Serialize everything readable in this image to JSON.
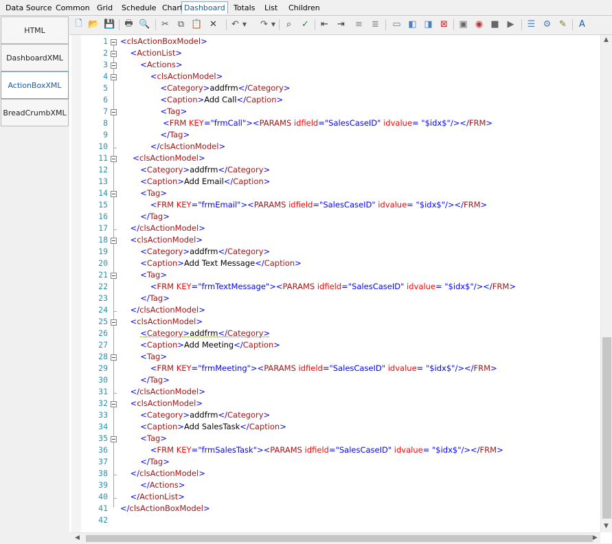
{
  "menu": {
    "items": [
      {
        "label": "Data Source"
      },
      {
        "label": "Common"
      },
      {
        "label": "Grid"
      },
      {
        "label": "Schedule"
      },
      {
        "label": "Chart"
      },
      {
        "label": "Dashboard"
      },
      {
        "label": "Totals"
      },
      {
        "label": "List"
      },
      {
        "label": "Children"
      }
    ],
    "active": "Dashboard"
  },
  "nav_tabs": [
    {
      "label": "HTML"
    },
    {
      "label": "DashboardXML"
    },
    {
      "label": "ActionBoxXML"
    },
    {
      "label": "BreadCrumbXML"
    }
  ],
  "selected_tab": "ActionBoxXML",
  "toolbar_icons": [
    "new-document-icon",
    "open-folder-icon",
    "save-icon",
    "print-icon",
    "print-preview-icon",
    "cut-icon",
    "copy-icon",
    "paste-icon",
    "delete-icon",
    "undo-icon",
    "redo-icon",
    "find-icon",
    "spell-check-icon",
    "outdent-icon",
    "indent-icon",
    "comment-icon",
    "uncomment-icon",
    "bookmark-icon",
    "bookmark-prev-icon",
    "bookmark-next-icon",
    "bookmark-clear-icon",
    "macro-icon",
    "macro-record-icon",
    "macro-stop-icon",
    "macro-play-icon",
    "properties-icon",
    "format-icon",
    "highlight-icon",
    "font-icon"
  ],
  "code_lines": [
    [
      [
        "tk",
        "<"
      ],
      [
        "tn",
        "clsActionBoxModel"
      ],
      [
        "tk",
        ">"
      ]
    ],
    [
      [
        "tx",
        "    "
      ],
      [
        "tk",
        "<"
      ],
      [
        "tn",
        "ActionList"
      ],
      [
        "tk",
        ">"
      ]
    ],
    [
      [
        "tx",
        "        "
      ],
      [
        "tk",
        "<"
      ],
      [
        "tn",
        "Actions"
      ],
      [
        "tk",
        ">"
      ]
    ],
    [
      [
        "tx",
        "            "
      ],
      [
        "tk",
        "<"
      ],
      [
        "tn",
        "clsActionModel"
      ],
      [
        "tk",
        ">"
      ]
    ],
    [
      [
        "tx",
        "                "
      ],
      [
        "tk",
        "<"
      ],
      [
        "tn",
        "Category"
      ],
      [
        "tk",
        ">"
      ],
      [
        "tx",
        "addfrm"
      ],
      [
        "tk",
        "</"
      ],
      [
        "tn",
        "Category"
      ],
      [
        "tk",
        ">"
      ]
    ],
    [
      [
        "tx",
        "                "
      ],
      [
        "tk",
        "<"
      ],
      [
        "tn",
        "Caption"
      ],
      [
        "tk",
        ">"
      ],
      [
        "tx",
        "Add Call"
      ],
      [
        "tk",
        "</"
      ],
      [
        "tn",
        "Caption"
      ],
      [
        "tk",
        ">"
      ]
    ],
    [
      [
        "tx",
        "                "
      ],
      [
        "tk",
        "<"
      ],
      [
        "tn",
        "Tag"
      ],
      [
        "tk",
        ">"
      ]
    ],
    [
      [
        "tx",
        "                 "
      ],
      [
        "tk",
        "<"
      ],
      [
        "tn",
        "FRM"
      ],
      [
        "at",
        " KEY"
      ],
      [
        "tk",
        "="
      ],
      [
        "av",
        "\"frmCall\""
      ],
      [
        "tk",
        ">"
      ],
      [
        "tk",
        "<"
      ],
      [
        "tn",
        "PARAMS"
      ],
      [
        "at",
        " idfield"
      ],
      [
        "tk",
        "="
      ],
      [
        "av",
        "\"SalesCaseID\""
      ],
      [
        "at",
        " idvalue"
      ],
      [
        "tk",
        "= "
      ],
      [
        "av",
        "\"$idx$\""
      ],
      [
        "tk",
        "/></"
      ],
      [
        "tn",
        "FRM"
      ],
      [
        "tk",
        ">"
      ]
    ],
    [
      [
        "tx",
        "                "
      ],
      [
        "tk",
        "</"
      ],
      [
        "tn",
        "Tag"
      ],
      [
        "tk",
        ">"
      ]
    ],
    [
      [
        "tx",
        "            "
      ],
      [
        "tk",
        "</"
      ],
      [
        "tn",
        "clsActionModel"
      ],
      [
        "tk",
        ">"
      ]
    ],
    [
      [
        "tx",
        "     "
      ],
      [
        "tk",
        "<"
      ],
      [
        "tn",
        "clsActionModel"
      ],
      [
        "tk",
        ">"
      ]
    ],
    [
      [
        "tx",
        "        "
      ],
      [
        "tk",
        "<"
      ],
      [
        "tn",
        "Category"
      ],
      [
        "tk",
        ">"
      ],
      [
        "tx",
        "addfrm"
      ],
      [
        "tk",
        "</"
      ],
      [
        "tn",
        "Category"
      ],
      [
        "tk",
        ">"
      ]
    ],
    [
      [
        "tx",
        "        "
      ],
      [
        "tk",
        "<"
      ],
      [
        "tn",
        "Caption"
      ],
      [
        "tk",
        ">"
      ],
      [
        "tx",
        "Add Email"
      ],
      [
        "tk",
        "</"
      ],
      [
        "tn",
        "Caption"
      ],
      [
        "tk",
        ">"
      ]
    ],
    [
      [
        "tx",
        "        "
      ],
      [
        "tk",
        "<"
      ],
      [
        "tn",
        "Tag"
      ],
      [
        "tk",
        ">"
      ]
    ],
    [
      [
        "tx",
        "            "
      ],
      [
        "tk",
        "<"
      ],
      [
        "tn",
        "FRM"
      ],
      [
        "at",
        " KEY"
      ],
      [
        "tk",
        "="
      ],
      [
        "av",
        "\"frmEmail\""
      ],
      [
        "tk",
        ">"
      ],
      [
        "tk",
        "<"
      ],
      [
        "tn",
        "PARAMS"
      ],
      [
        "at",
        " idfield"
      ],
      [
        "tk",
        "="
      ],
      [
        "av",
        "\"SalesCaseID\""
      ],
      [
        "at",
        " idvalue"
      ],
      [
        "tk",
        "= "
      ],
      [
        "av",
        "\"$idx$\""
      ],
      [
        "tk",
        "/></"
      ],
      [
        "tn",
        "FRM"
      ],
      [
        "tk",
        ">"
      ]
    ],
    [
      [
        "tx",
        "        "
      ],
      [
        "tk",
        "</"
      ],
      [
        "tn",
        "Tag"
      ],
      [
        "tk",
        ">"
      ]
    ],
    [
      [
        "tx",
        "    "
      ],
      [
        "tk",
        "</"
      ],
      [
        "tn",
        "clsActionModel"
      ],
      [
        "tk",
        ">"
      ]
    ],
    [
      [
        "tx",
        "    "
      ],
      [
        "tk",
        "<"
      ],
      [
        "tn",
        "clsActionModel"
      ],
      [
        "tk",
        ">"
      ]
    ],
    [
      [
        "tx",
        "        "
      ],
      [
        "tk",
        "<"
      ],
      [
        "tn",
        "Category"
      ],
      [
        "tk",
        ">"
      ],
      [
        "tx",
        "addfrm"
      ],
      [
        "tk",
        "</"
      ],
      [
        "tn",
        "Category"
      ],
      [
        "tk",
        ">"
      ]
    ],
    [
      [
        "tx",
        "        "
      ],
      [
        "tk",
        "<"
      ],
      [
        "tn",
        "Caption"
      ],
      [
        "tk",
        ">"
      ],
      [
        "tx",
        "Add Text Message"
      ],
      [
        "tk",
        "</"
      ],
      [
        "tn",
        "Caption"
      ],
      [
        "tk",
        ">"
      ]
    ],
    [
      [
        "tx",
        "        "
      ],
      [
        "tk",
        "<"
      ],
      [
        "tn",
        "Tag"
      ],
      [
        "tk",
        ">"
      ]
    ],
    [
      [
        "tx",
        "            "
      ],
      [
        "tk",
        "<"
      ],
      [
        "tn",
        "FRM"
      ],
      [
        "at",
        " KEY"
      ],
      [
        "tk",
        "="
      ],
      [
        "av",
        "\"frmTextMessage\""
      ],
      [
        "tk",
        ">"
      ],
      [
        "tk",
        "<"
      ],
      [
        "tn",
        "PARAMS"
      ],
      [
        "at",
        " idfield"
      ],
      [
        "tk",
        "="
      ],
      [
        "av",
        "\"SalesCaseID\""
      ],
      [
        "at",
        " idvalue"
      ],
      [
        "tk",
        "= "
      ],
      [
        "av",
        "\"$idx$\""
      ],
      [
        "tk",
        "/></"
      ],
      [
        "tn",
        "FRM"
      ],
      [
        "tk",
        ">"
      ]
    ],
    [
      [
        "tx",
        "        "
      ],
      [
        "tk",
        "</"
      ],
      [
        "tn",
        "Tag"
      ],
      [
        "tk",
        ">"
      ]
    ],
    [
      [
        "tx",
        "    "
      ],
      [
        "tk",
        "</"
      ],
      [
        "tn",
        "clsActionModel"
      ],
      [
        "tk",
        ">"
      ]
    ],
    [
      [
        "tx",
        "    "
      ],
      [
        "tk",
        "<"
      ],
      [
        "tn",
        "clsActionModel"
      ],
      [
        "tk",
        ">"
      ]
    ],
    [
      [
        "tx",
        "        "
      ],
      [
        "tk",
        "<"
      ],
      [
        "tn",
        "Category"
      ],
      [
        "tk",
        ">"
      ],
      [
        "tx",
        "addfrm"
      ],
      [
        "tk",
        "</"
      ],
      [
        "tn",
        "Category"
      ],
      [
        "tk",
        ">"
      ]
    ],
    [
      [
        "tx",
        "        "
      ],
      [
        "tk",
        "<"
      ],
      [
        "tn",
        "Caption"
      ],
      [
        "tk",
        ">"
      ],
      [
        "tx",
        "Add Meeting"
      ],
      [
        "tk",
        "</"
      ],
      [
        "tn",
        "Caption"
      ],
      [
        "tk",
        ">"
      ]
    ],
    [
      [
        "tx",
        "        "
      ],
      [
        "tk",
        "<"
      ],
      [
        "tn",
        "Tag"
      ],
      [
        "tk",
        ">"
      ]
    ],
    [
      [
        "tx",
        "            "
      ],
      [
        "tk",
        "<"
      ],
      [
        "tn",
        "FRM"
      ],
      [
        "at",
        " KEY"
      ],
      [
        "tk",
        "="
      ],
      [
        "av",
        "\"frmMeeting\""
      ],
      [
        "tk",
        ">"
      ],
      [
        "tk",
        "<"
      ],
      [
        "tn",
        "PARAMS"
      ],
      [
        "at",
        " idfield"
      ],
      [
        "tk",
        "="
      ],
      [
        "av",
        "\"SalesCaseID\""
      ],
      [
        "at",
        " idvalue"
      ],
      [
        "tk",
        "= "
      ],
      [
        "av",
        "\"$idx$\""
      ],
      [
        "tk",
        "/></"
      ],
      [
        "tn",
        "FRM"
      ],
      [
        "tk",
        ">"
      ]
    ],
    [
      [
        "tx",
        "        "
      ],
      [
        "tk",
        "</"
      ],
      [
        "tn",
        "Tag"
      ],
      [
        "tk",
        ">"
      ]
    ],
    [
      [
        "tx",
        "    "
      ],
      [
        "tk",
        "</"
      ],
      [
        "tn",
        "clsActionModel"
      ],
      [
        "tk",
        ">"
      ]
    ],
    [
      [
        "tx",
        "    "
      ],
      [
        "tk",
        "<"
      ],
      [
        "tn",
        "clsActionModel"
      ],
      [
        "tk",
        ">"
      ]
    ],
    [
      [
        "tx",
        "        "
      ],
      [
        "tk",
        "<"
      ],
      [
        "tn",
        "Category"
      ],
      [
        "tk",
        ">"
      ],
      [
        "tx",
        "addfrm"
      ],
      [
        "tk",
        "</"
      ],
      [
        "tn",
        "Category"
      ],
      [
        "tk",
        ">"
      ]
    ],
    [
      [
        "tx",
        "        "
      ],
      [
        "tk",
        "<"
      ],
      [
        "tn",
        "Caption"
      ],
      [
        "tk",
        ">"
      ],
      [
        "tx",
        "Add SalesTask"
      ],
      [
        "tk",
        "</"
      ],
      [
        "tn",
        "Caption"
      ],
      [
        "tk",
        ">"
      ]
    ],
    [
      [
        "tx",
        "        "
      ],
      [
        "tk",
        "<"
      ],
      [
        "tn",
        "Tag"
      ],
      [
        "tk",
        ">"
      ]
    ],
    [
      [
        "tx",
        "            "
      ],
      [
        "tk",
        "<"
      ],
      [
        "tn",
        "FRM"
      ],
      [
        "at",
        " KEY"
      ],
      [
        "tk",
        "="
      ],
      [
        "av",
        "\"frmSalesTask\""
      ],
      [
        "tk",
        ">"
      ],
      [
        "tk",
        "<"
      ],
      [
        "tn",
        "PARAMS"
      ],
      [
        "at",
        " idfield"
      ],
      [
        "tk",
        "="
      ],
      [
        "av",
        "\"SalesCaseID\""
      ],
      [
        "at",
        " idvalue"
      ],
      [
        "tk",
        "= "
      ],
      [
        "av",
        "\"$idx$\""
      ],
      [
        "tk",
        "/></"
      ],
      [
        "tn",
        "FRM"
      ],
      [
        "tk",
        ">"
      ]
    ],
    [
      [
        "tx",
        "        "
      ],
      [
        "tk",
        "</"
      ],
      [
        "tn",
        "Tag"
      ],
      [
        "tk",
        ">"
      ]
    ],
    [
      [
        "tx",
        "    "
      ],
      [
        "tk",
        "</"
      ],
      [
        "tn",
        "clsActionModel"
      ],
      [
        "tk",
        ">"
      ]
    ],
    [
      [
        "tx",
        "        "
      ],
      [
        "tk",
        "</"
      ],
      [
        "tn",
        "Actions"
      ],
      [
        "tk",
        ">"
      ]
    ],
    [
      [
        "tx",
        "    "
      ],
      [
        "tk",
        "</"
      ],
      [
        "tn",
        "ActionList"
      ],
      [
        "tk",
        ">"
      ]
    ],
    [
      [
        "tk",
        "</"
      ],
      [
        "tn",
        "clsActionBoxModel"
      ],
      [
        "tk",
        ">"
      ]
    ],
    []
  ],
  "line_numbers": [
    "1",
    "2",
    "3",
    "4",
    "5",
    "6",
    "7",
    "8",
    "9",
    "10",
    "11",
    "12",
    "13",
    "14",
    "15",
    "16",
    "17",
    "18",
    "19",
    "20",
    "21",
    "22",
    "23",
    "24",
    "25",
    "26",
    "27",
    "28",
    "29",
    "30",
    "31",
    "32",
    "33",
    "34",
    "35",
    "36",
    "37",
    "38",
    "39",
    "40",
    "41",
    "42"
  ],
  "fold_lines": [
    1,
    2,
    3,
    4,
    7,
    11,
    14,
    18,
    21,
    25,
    28,
    32,
    35
  ],
  "colors": {
    "tag_bracket": "#0000ff",
    "tag_name": "#a31515",
    "attribute": "#ff0000",
    "attribute_value": "#0000ff",
    "line_number": "#2b91af",
    "active_tab": "#1a5aa8"
  }
}
